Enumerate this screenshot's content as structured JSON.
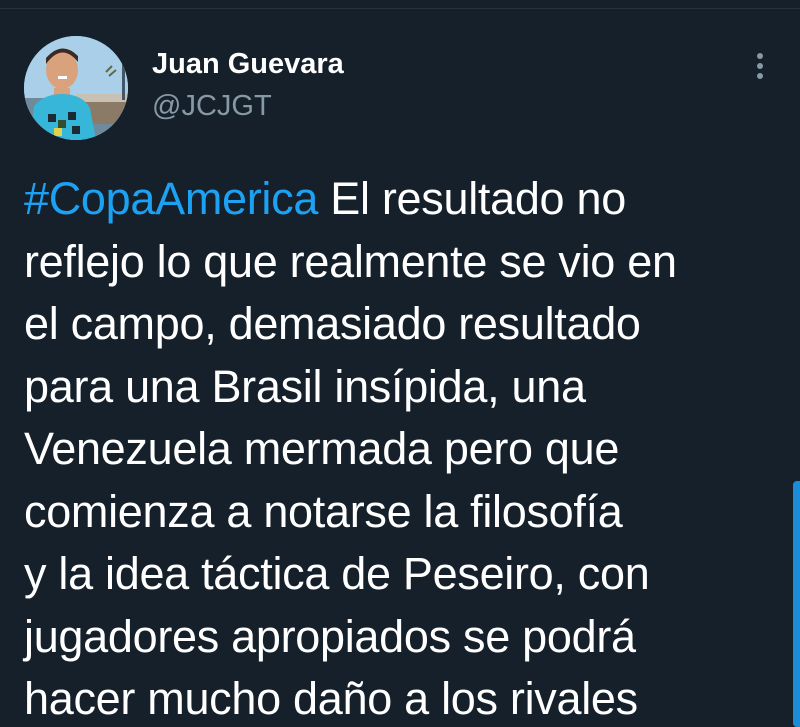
{
  "user": {
    "display_name": "Juan Guevara",
    "handle": "@JCJGT"
  },
  "menu": {
    "icon": "more-vertical-icon"
  },
  "tweet": {
    "hashtag": "#CopaAmerica",
    "lines": [
      " El resultado no",
      "reflejo lo que realmente se vio en",
      "el campo, demasiado resultado",
      "para una Brasil insípida, una",
      "Venezuela mermada pero que",
      "comienza a notarse la filosofía",
      "y la idea táctica de Peseiro, con",
      "jugadores apropiados se podrá",
      "hacer mucho daño a los rivales"
    ]
  },
  "colors": {
    "background": "#15202b",
    "text": "#ffffff",
    "secondary_text": "#8899a6",
    "link": "#1da1f2",
    "scroll_indicator": "#1a8cd8"
  }
}
